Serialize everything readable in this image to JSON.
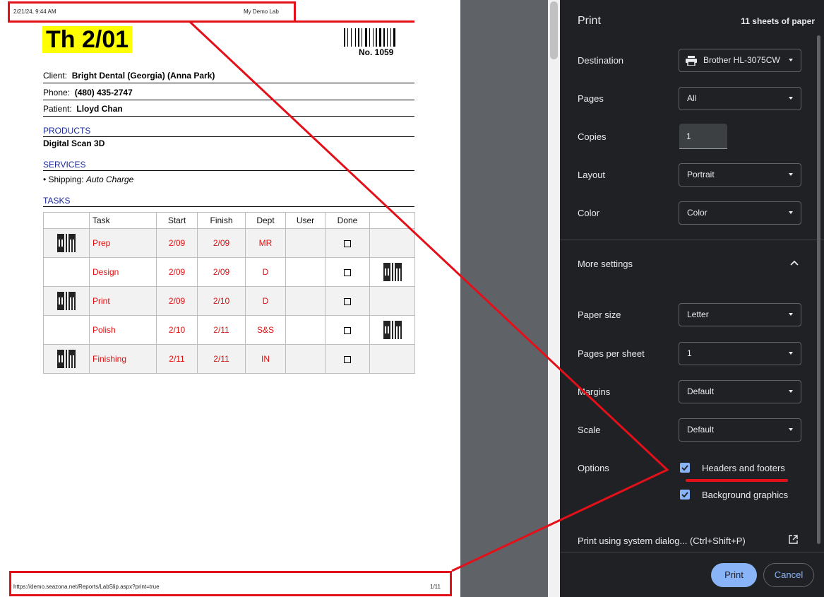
{
  "preview": {
    "header_left": "2/21/24, 9:44 AM",
    "header_center": "My Demo Lab",
    "date_title": "Th 2/01",
    "order_no": "No. 1059",
    "client_label": "Client:",
    "client_value": "Bright Dental (Georgia) (Anna Park)",
    "phone_label": "Phone:",
    "phone_value": "(480) 435-2747",
    "patient_label": "Patient:",
    "patient_value": "Lloyd Chan",
    "products_heading": "PRODUCTS",
    "product_item": "Digital Scan 3D",
    "services_heading": "SERVICES",
    "service_label": "Shipping:",
    "service_value": "Auto Charge",
    "tasks_heading": "TASKS",
    "columns": [
      "",
      "Task",
      "Start",
      "Finish",
      "Dept",
      "User",
      "Done",
      ""
    ],
    "rows": [
      {
        "task": "Prep",
        "start": "2/09",
        "finish": "2/09",
        "dept": "MR",
        "qr": "left"
      },
      {
        "task": "Design",
        "start": "2/09",
        "finish": "2/09",
        "dept": "D",
        "qr": "right"
      },
      {
        "task": "Print",
        "start": "2/09",
        "finish": "2/10",
        "dept": "D",
        "qr": "left"
      },
      {
        "task": "Polish",
        "start": "2/10",
        "finish": "2/11",
        "dept": "S&S",
        "qr": "right"
      },
      {
        "task": "Finishing",
        "start": "2/11",
        "finish": "2/11",
        "dept": "IN",
        "qr": "left"
      }
    ],
    "footer_url": "https://demo.seazona.net/Reports/LabSlip.aspx?print=true",
    "footer_page": "1/11"
  },
  "dialog": {
    "title": "Print",
    "sheets": "11 sheets of paper",
    "destination_label": "Destination",
    "destination_value": "Brother HL-3075CW",
    "pages_label": "Pages",
    "pages_value": "All",
    "copies_label": "Copies",
    "copies_value": "1",
    "layout_label": "Layout",
    "layout_value": "Portrait",
    "color_label": "Color",
    "color_value": "Color",
    "more_settings": "More settings",
    "paper_size_label": "Paper size",
    "paper_size_value": "Letter",
    "pages_per_sheet_label": "Pages per sheet",
    "pages_per_sheet_value": "1",
    "margins_label": "Margins",
    "margins_value": "Default",
    "scale_label": "Scale",
    "scale_value": "Default",
    "options_label": "Options",
    "headers_footers": "Headers and footers",
    "background_graphics": "Background graphics",
    "system_dialog": "Print using system dialog... (Ctrl+Shift+P)",
    "print_button": "Print",
    "cancel_button": "Cancel",
    "accent": "#8ab4f8"
  },
  "annotation_color": "#e3101a"
}
